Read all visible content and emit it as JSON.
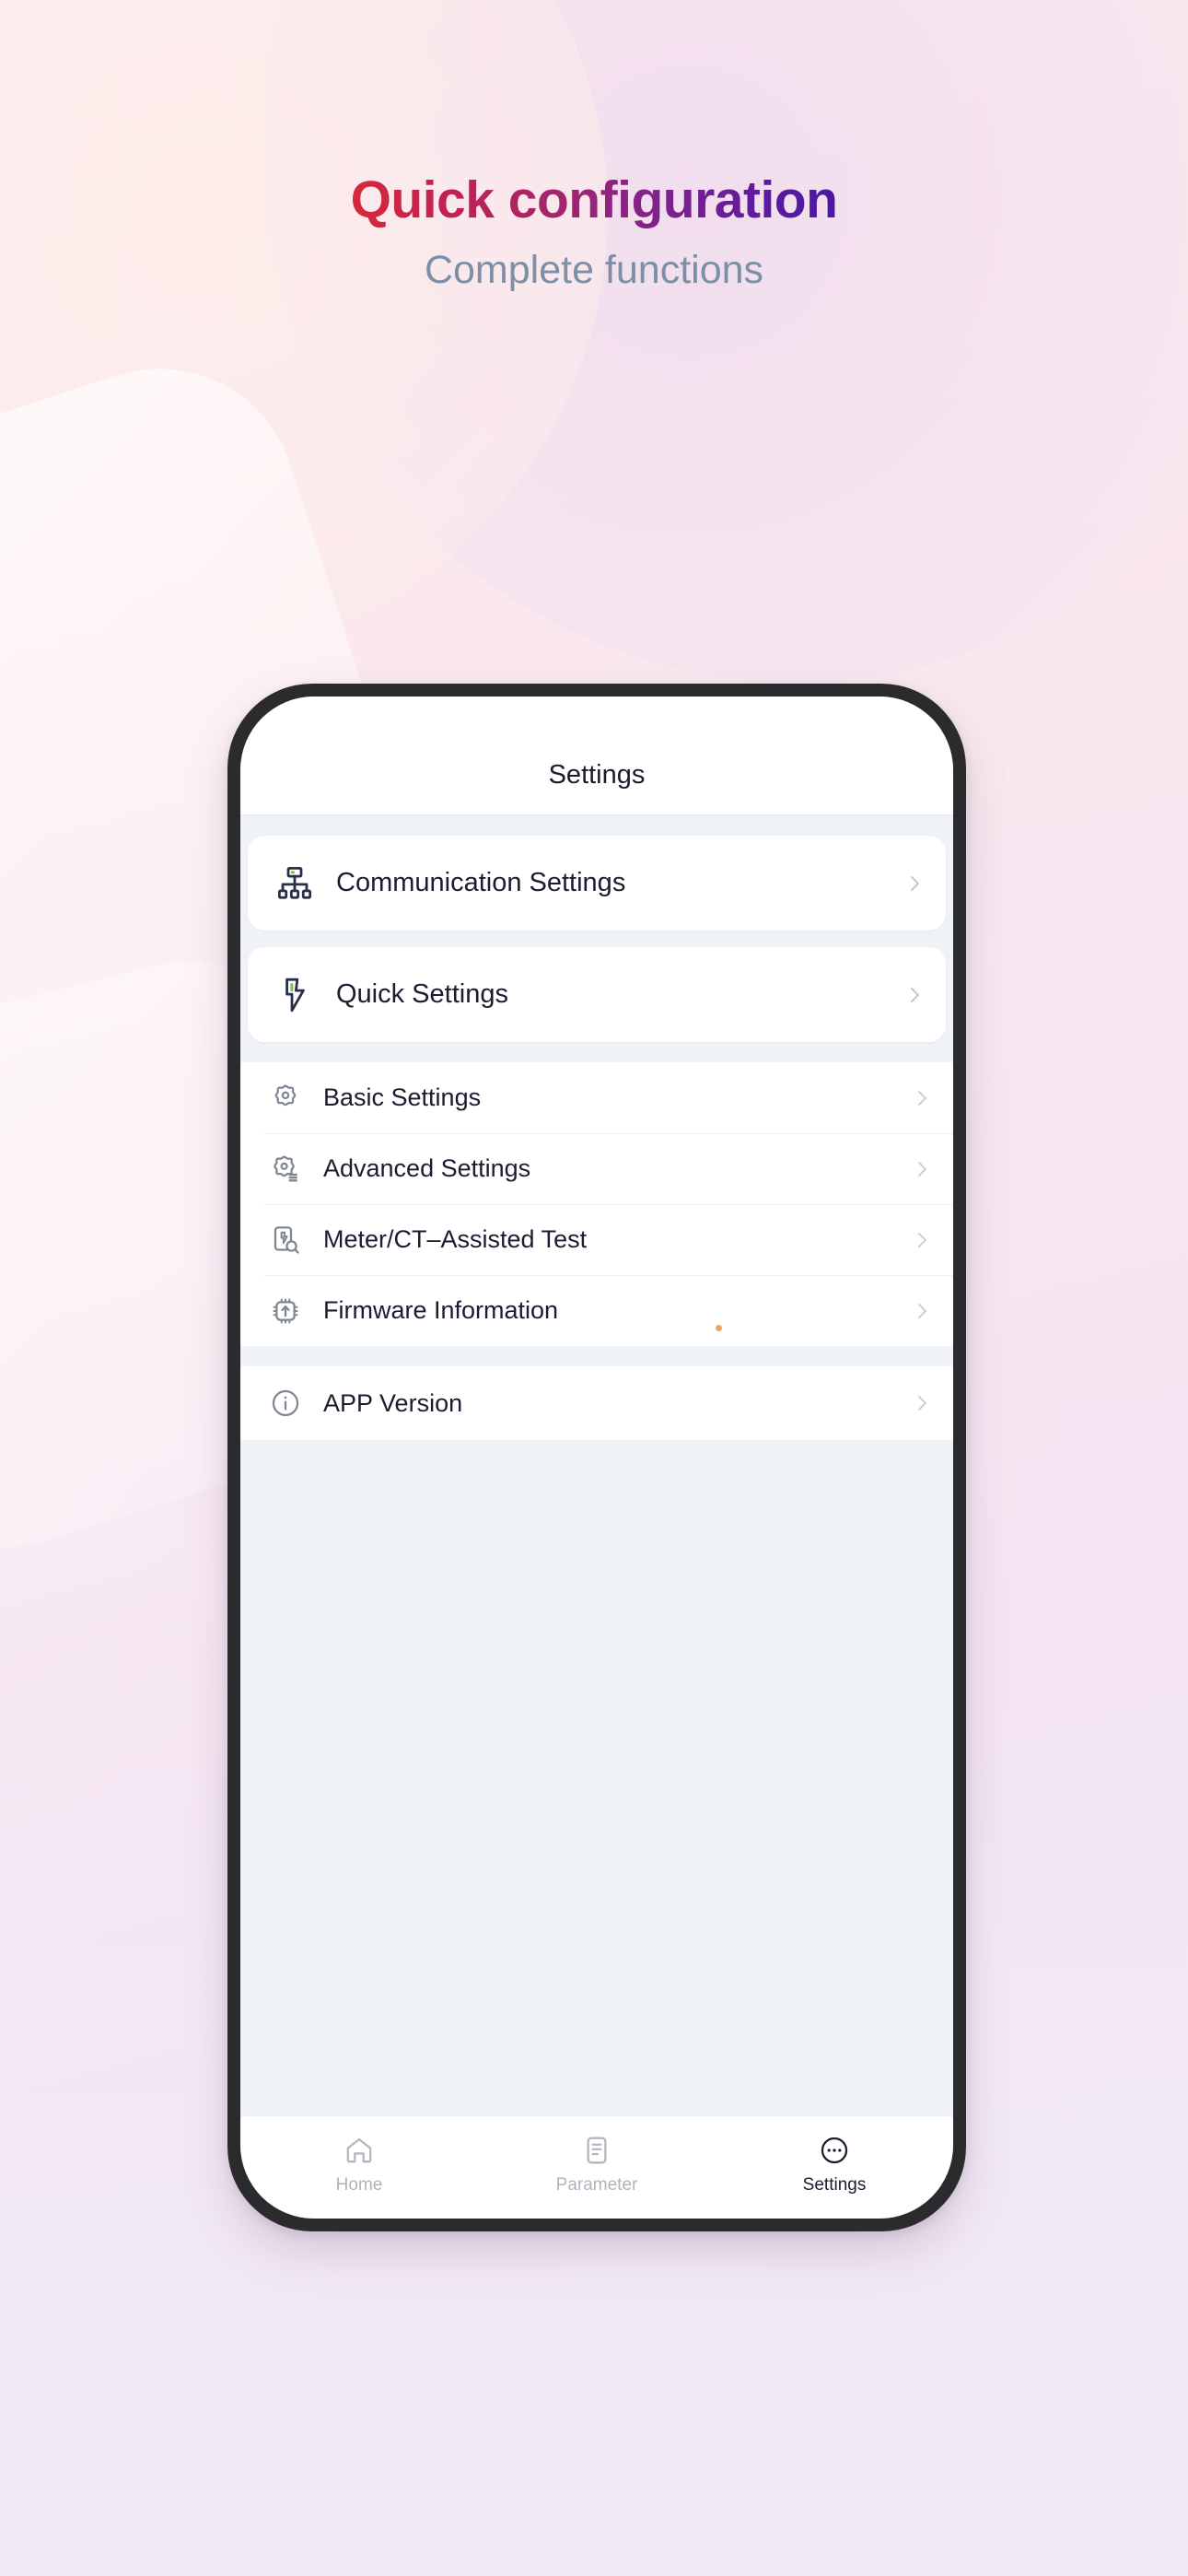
{
  "hero": {
    "title": "Quick configuration",
    "subtitle": "Complete functions",
    "title_gradient_from": "#D6293A",
    "title_gradient_to": "#4A17A4",
    "subtitle_color": "#7D8FA5"
  },
  "background": {
    "top_left_color": "#FBEAEB",
    "top_right_color": "#F5E2EF",
    "bottom_color": "#F1E8F5"
  },
  "phone": {
    "header": {
      "title": "Settings"
    },
    "accent_green": "#7CC142",
    "badge_orange": "#F2A25C",
    "groups": [
      {
        "style": "cards",
        "items": [
          {
            "label": "Communication Settings",
            "icon": "network-tree-icon",
            "chevron": "chevron-right-icon"
          },
          {
            "label": "Quick Settings",
            "icon": "lightning-bolt-icon",
            "chevron": "chevron-right-icon"
          }
        ]
      },
      {
        "style": "flat",
        "items": [
          {
            "label": "Basic Settings",
            "icon": "gear-icon",
            "chevron": "chevron-right-icon"
          },
          {
            "label": "Advanced Settings",
            "icon": "gear-list-icon",
            "chevron": "chevron-right-icon"
          },
          {
            "label": "Meter/CT–Assisted Test",
            "icon": "meter-search-icon",
            "chevron": "chevron-right-icon"
          },
          {
            "label": "Firmware Information",
            "icon": "chip-upload-icon",
            "chevron": "chevron-right-icon",
            "badge": true
          }
        ]
      },
      {
        "style": "flat",
        "items": [
          {
            "label": "APP Version",
            "icon": "info-circle-icon",
            "chevron": "chevron-right-icon"
          }
        ]
      }
    ],
    "tabs": [
      {
        "label": "Home",
        "icon": "home-icon",
        "active": false
      },
      {
        "label": "Parameter",
        "icon": "document-lines-icon",
        "active": false
      },
      {
        "label": "Settings",
        "icon": "ellipsis-circle-icon",
        "active": true
      }
    ]
  }
}
